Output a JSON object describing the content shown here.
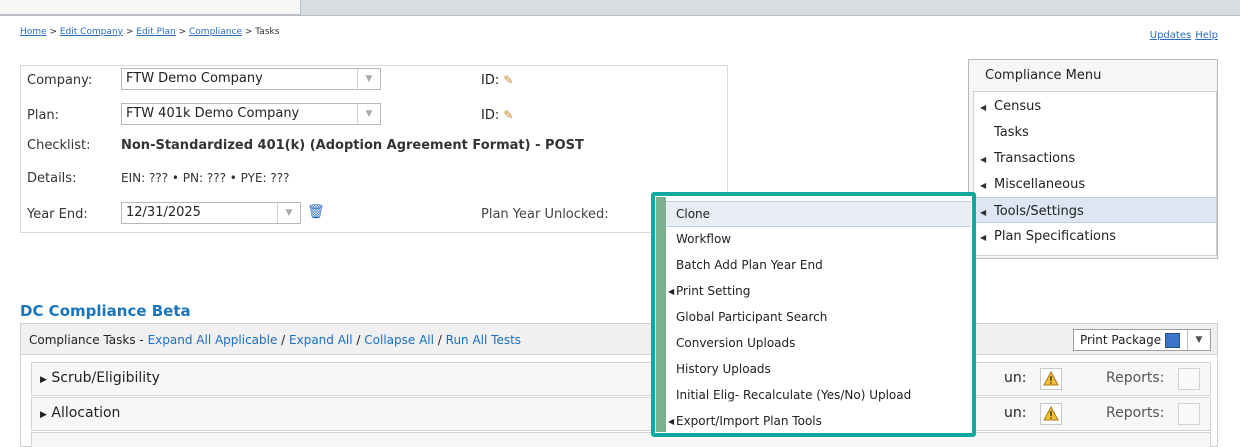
{
  "breadcrumb": [
    "Home",
    "Edit Company",
    "Edit Plan",
    "Compliance",
    "Tasks"
  ],
  "breadcrumb_sep": ">",
  "top_links": {
    "updates": "Updates",
    "help": "Help"
  },
  "info": {
    "company_label": "Company:",
    "company_value": "FTW Demo Company",
    "plan_label": "Plan:",
    "plan_value": "FTW 401k Demo Company",
    "id_label": "ID:",
    "checklist_label": "Checklist:",
    "checklist_value": "Non-Standardized 401(k) (Adoption Agreement Format) - POST",
    "details_label": "Details:",
    "details_value": "EIN: ??? • PN: ??? • PYE: ???",
    "year_end_label": "Year End:",
    "year_end_value": "12/31/2025",
    "plan_year_unlocked_label": "Plan Year Unlocked:"
  },
  "compliance_menu": {
    "title": "Compliance Menu",
    "items": [
      {
        "label": "Census",
        "has_submenu": true
      },
      {
        "label": "Tasks",
        "has_submenu": false
      },
      {
        "label": "Transactions",
        "has_submenu": true
      },
      {
        "label": "Miscellaneous",
        "has_submenu": true
      },
      {
        "label": "Tools/Settings",
        "has_submenu": true,
        "active": true
      },
      {
        "label": "Plan Specifications",
        "has_submenu": true
      }
    ]
  },
  "tools_submenu": [
    {
      "label": "Clone",
      "has_submenu": false
    },
    {
      "label": "Workflow",
      "has_submenu": false
    },
    {
      "label": "Batch Add Plan Year End",
      "has_submenu": false
    },
    {
      "label": "Print Setting",
      "has_submenu": true
    },
    {
      "label": "Global Participant Search",
      "has_submenu": false
    },
    {
      "label": "Conversion Uploads",
      "has_submenu": false
    },
    {
      "label": "History Uploads",
      "has_submenu": false
    },
    {
      "label": "Initial Elig- Recalculate (Yes/No) Upload",
      "has_submenu": false
    },
    {
      "label": "Export/Import Plan Tools",
      "has_submenu": true
    }
  ],
  "dc": {
    "title": "DC Compliance Beta",
    "tasks_label": "Compliance Tasks -",
    "expand_all_applicable": "Expand All Applicable",
    "expand_all": "Expand All",
    "collapse_all": "Collapse All",
    "run_all_tests": "Run All Tests",
    "print_package": "Print Package",
    "rows": [
      {
        "name": "Scrub/Eligibility",
        "run_label": "un:",
        "reports_label": "Reports:"
      },
      {
        "name": "Allocation",
        "run_label": "un:",
        "reports_label": "Reports:"
      }
    ]
  },
  "colors": {
    "accent": "#13a89e",
    "link": "#1b75bb"
  }
}
